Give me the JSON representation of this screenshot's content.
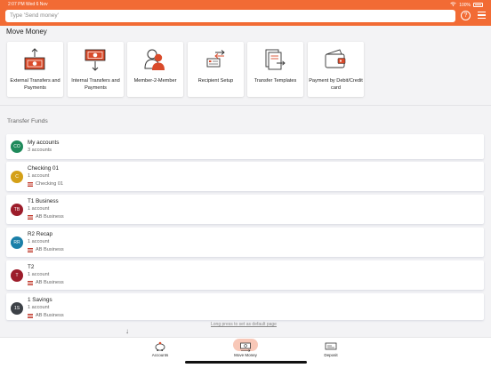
{
  "status": {
    "time": "2:07 PM",
    "date": "Wed 6 Nov",
    "battery": "100%"
  },
  "search": {
    "placeholder": "Type 'Send money'"
  },
  "move_money": {
    "title": "Move Money",
    "tiles": [
      {
        "label": "External Transfers and Payments",
        "icon": "money-upload-icon"
      },
      {
        "label": "Internal Transfers and Payments",
        "icon": "money-download-icon"
      },
      {
        "label": "Member-2-Member",
        "icon": "members-icon"
      },
      {
        "label": "Recipient Setup",
        "icon": "recipient-setup-icon"
      },
      {
        "label": "Transfer Templates",
        "icon": "transfer-templates-icon"
      },
      {
        "label": "Payment by Debit/Credit card",
        "icon": "wallet-card-icon"
      }
    ]
  },
  "transfer_funds": {
    "title": "Transfer Funds",
    "accounts": [
      {
        "initials": "CO",
        "color": "#1f8a5b",
        "name": "My accounts",
        "count": "3 accounts"
      },
      {
        "initials": "C",
        "color": "#d4a017",
        "name": "Checking 01",
        "count": "1 account",
        "sub": "Checking 01"
      },
      {
        "initials": "TB",
        "color": "#9c1c2a",
        "name": "T1 Business",
        "count": "1 account",
        "sub": "AB Business"
      },
      {
        "initials": "RR",
        "color": "#1a7fa8",
        "name": "R2 Recap",
        "count": "1 account",
        "sub": "AB Business"
      },
      {
        "initials": "T",
        "color": "#9c1c2a",
        "name": "T2",
        "count": "1 account",
        "sub": "AB Business"
      },
      {
        "initials": "1S",
        "color": "#3d4147",
        "name": "1 Savings",
        "count": "1 account",
        "sub": "AB Business"
      }
    ],
    "hint": "Long press to set as default page"
  },
  "tabs": [
    {
      "label": "Accounts",
      "icon": "piggy-bank-icon",
      "active": false
    },
    {
      "label": "Move Money",
      "icon": "move-money-icon",
      "active": true
    },
    {
      "label": "Deposit",
      "icon": "check-deposit-icon",
      "active": false
    }
  ],
  "colors": {
    "brand": "#f26b34",
    "active_tab_bubble": "#f8c8b8"
  }
}
